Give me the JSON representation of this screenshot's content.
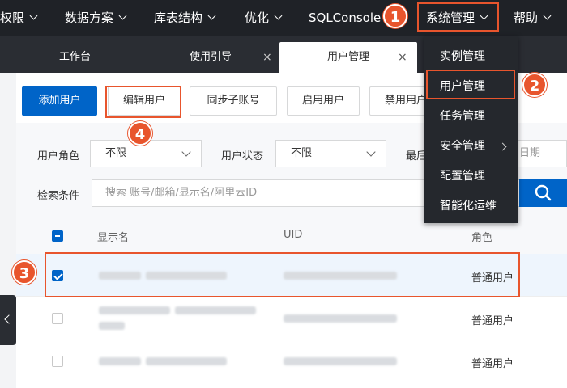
{
  "topnav": {
    "items": [
      {
        "label": "权限"
      },
      {
        "label": "数据方案"
      },
      {
        "label": "库表结构"
      },
      {
        "label": "优化"
      },
      {
        "label": "SQLConsole"
      },
      {
        "label": "系统管理"
      },
      {
        "label": "帮助"
      }
    ]
  },
  "tabs": [
    {
      "label": "工作台"
    },
    {
      "label": "使用引导"
    },
    {
      "label": "用户管理"
    }
  ],
  "tab_close_glyph": "×",
  "toolbar": {
    "add_user": "添加用户",
    "edit_user": "编辑用户",
    "sync_sub_account": "同步子账号",
    "enable_user": "启用用户",
    "disable_user": "禁用用户"
  },
  "filters": {
    "role_label": "用户角色",
    "role_value": "不限",
    "status_label": "用户状态",
    "status_value": "不限",
    "last_label": "最后",
    "date_placeholder": "日期",
    "search_label": "检索条件",
    "search_placeholder": "搜索 账号/邮箱/显示名/阿里云ID"
  },
  "table": {
    "columns": [
      "显示名",
      "UID",
      "角色"
    ],
    "rows": [
      {
        "role": "普通用户",
        "selected": true
      },
      {
        "role": "普通用户",
        "selected": false
      },
      {
        "role": "普通用户",
        "selected": false
      }
    ]
  },
  "dropdown": {
    "items": [
      {
        "label": "实例管理"
      },
      {
        "label": "用户管理"
      },
      {
        "label": "任务管理"
      },
      {
        "label": "安全管理"
      },
      {
        "label": "配置管理"
      },
      {
        "label": "智能化运维"
      }
    ]
  },
  "annotations": {
    "badges": [
      "1",
      "2",
      "3",
      "4"
    ]
  },
  "colors": {
    "accent": "#0064c8",
    "annotation": "#e8552d",
    "nav_bg": "#1f2227"
  }
}
